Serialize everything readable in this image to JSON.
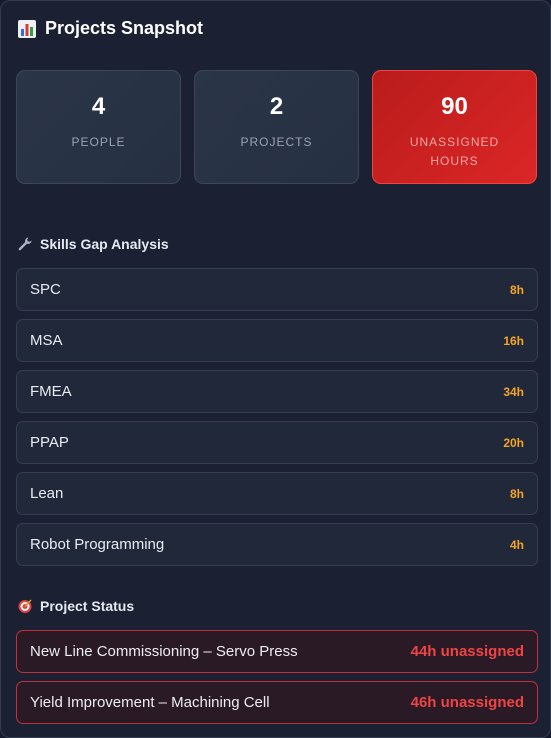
{
  "header": {
    "title": "Projects Snapshot",
    "icon": "bar-chart-icon"
  },
  "stats": [
    {
      "value": "4",
      "label": "PEOPLE"
    },
    {
      "value": "2",
      "label": "PROJECTS"
    },
    {
      "value": "90",
      "label": "UNASSIGNED HOURS"
    }
  ],
  "skills_section": {
    "title": "Skills Gap Analysis",
    "icon": "wrench-icon",
    "items": [
      {
        "name": "SPC",
        "hours": "8h"
      },
      {
        "name": "MSA",
        "hours": "16h"
      },
      {
        "name": "FMEA",
        "hours": "34h"
      },
      {
        "name": "PPAP",
        "hours": "20h"
      },
      {
        "name": "Lean",
        "hours": "8h"
      },
      {
        "name": "Robot Programming",
        "hours": "4h"
      }
    ]
  },
  "projects_section": {
    "title": "Project Status",
    "icon": "target-icon",
    "items": [
      {
        "name": "New Line Commissioning – Servo Press",
        "status": "44h unassigned"
      },
      {
        "name": "Yield Improvement – Machining Cell",
        "status": "46h unassigned"
      }
    ]
  },
  "colors": {
    "background": "#1b2133",
    "alert": "#dc2626",
    "hours_accent": "#f5a524",
    "status_red": "#ef4444"
  }
}
